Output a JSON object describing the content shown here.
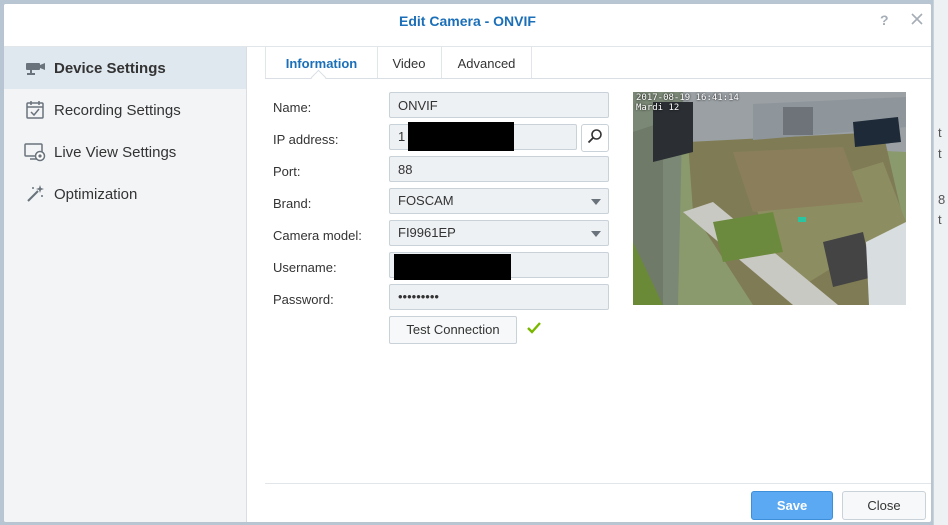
{
  "dialog": {
    "title": "Edit Camera - ONVIF"
  },
  "sidebar": {
    "items": [
      {
        "label": "Device Settings",
        "icon": "camera-icon",
        "active": true
      },
      {
        "label": "Recording Settings",
        "icon": "calendar-check-icon",
        "active": false
      },
      {
        "label": "Live View Settings",
        "icon": "live-view-icon",
        "active": false
      },
      {
        "label": "Optimization",
        "icon": "magic-wand-icon",
        "active": false
      }
    ]
  },
  "tabs": [
    {
      "label": "Information",
      "active": true
    },
    {
      "label": "Video",
      "active": false
    },
    {
      "label": "Advanced",
      "active": false
    }
  ],
  "form": {
    "name": {
      "label": "Name:",
      "value": "ONVIF"
    },
    "ip": {
      "label": "IP address:",
      "value": "1"
    },
    "port": {
      "label": "Port:",
      "value": "88"
    },
    "brand": {
      "label": "Brand:",
      "value": "FOSCAM"
    },
    "model": {
      "label": "Camera model:",
      "value": "FI9961EP"
    },
    "username": {
      "label": "Username:",
      "value": ""
    },
    "password": {
      "label": "Password:",
      "value": "•••••••••"
    },
    "test_connection_label": "Test Connection"
  },
  "preview": {
    "timestamp_line1": "2017-08-19 16:41:14",
    "timestamp_line2": "Mardi 12"
  },
  "footer": {
    "save_label": "Save",
    "close_label": "Close"
  },
  "right_strip": {
    "fragments": [
      "t",
      "t",
      "8",
      "t"
    ]
  },
  "colors": {
    "accent": "#1b6fb8",
    "save_button": "#5aa9f2",
    "success_check": "#7ab800"
  }
}
